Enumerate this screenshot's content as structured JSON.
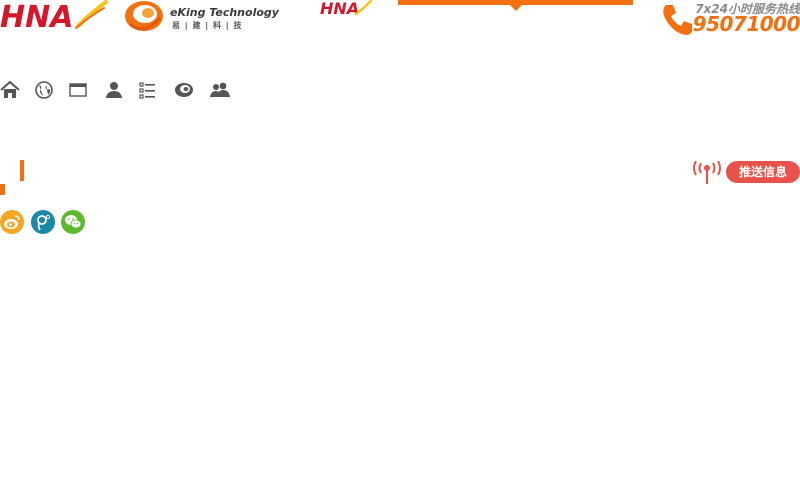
{
  "header": {
    "hna_logo_text": "HNA",
    "eking_name": "eKing Technology",
    "eking_cn": "易 | 建 | 科 | 技",
    "hna_small_text": "HNA",
    "hotline_label": "7x24小时服务热线",
    "hotline_number": "95071000"
  },
  "nav_icons": [
    {
      "name": "home-icon"
    },
    {
      "name": "globe-icon"
    },
    {
      "name": "browser-window-icon"
    },
    {
      "name": "user-icon"
    },
    {
      "name": "list-icon"
    },
    {
      "name": "eking-swirl-icon"
    },
    {
      "name": "group-icon"
    }
  ],
  "push": {
    "label": "推送信息"
  },
  "social": [
    {
      "name": "weibo-icon",
      "color": "#f5a623"
    },
    {
      "name": "tencent-weibo-icon",
      "color": "#1a88a8"
    },
    {
      "name": "wechat-icon",
      "color": "#5dba2f"
    }
  ],
  "colors": {
    "accent": "#f46f0f",
    "brand_red": "#d6162b",
    "push_red": "#e8524a"
  }
}
